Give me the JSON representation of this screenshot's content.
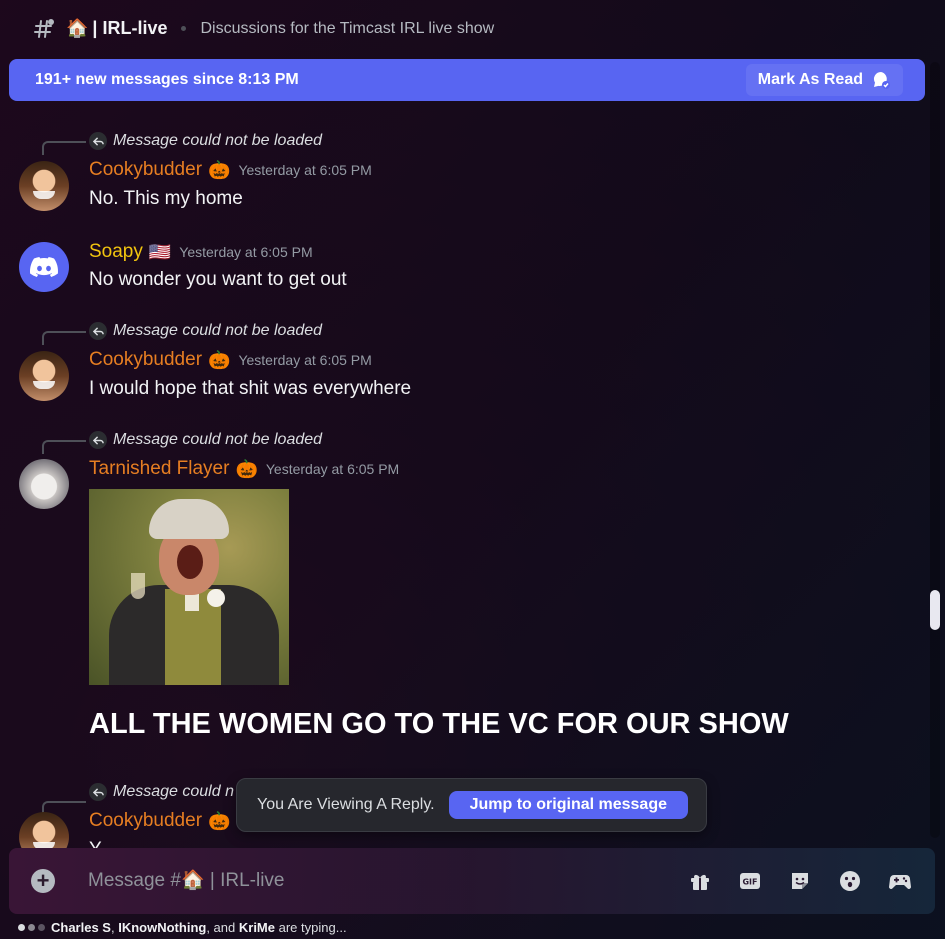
{
  "header": {
    "channel_emoji": "🏠",
    "channel_name": "| IRL-live",
    "topic": "Discussions for the Timcast IRL live show"
  },
  "banner": {
    "text": "191+ new messages since 8:13 PM",
    "mark_read_label": "Mark As Read"
  },
  "reply_ref_text": "Message could not be loaded",
  "messages": [
    {
      "author": "Cookybudder",
      "role_emoji": "🎃",
      "timestamp": "Yesterday at 6:05 PM",
      "text": "No. This my home",
      "is_reply": true
    },
    {
      "author": "Soapy",
      "role_emoji": "🇺🇸",
      "timestamp": "Yesterday at 6:05 PM",
      "text": "No wonder you want to get out",
      "is_reply": false
    },
    {
      "author": "Cookybudder",
      "role_emoji": "🎃",
      "timestamp": "Yesterday at 6:05 PM",
      "text": "I would hope that shit was everywhere",
      "is_reply": true
    },
    {
      "author": "Tarnished Flayer",
      "role_emoji": "🎃",
      "timestamp": "Yesterday at 6:05 PM",
      "text": "ALL THE WOMEN GO TO THE VC FOR OUR SHOW",
      "is_reply": true,
      "has_gif": true
    },
    {
      "author": "Cookybudder",
      "role_emoji": "🎃",
      "timestamp": "",
      "text": "Y",
      "is_reply": true
    }
  ],
  "partial_reply_text": "Message could n",
  "viewing_reply": {
    "text": "You Are Viewing A Reply.",
    "jump_label": "Jump to original message"
  },
  "composer": {
    "placeholder": "Message #🏠 | IRL-live"
  },
  "toolbar_icons": [
    "gift-icon",
    "gif-icon",
    "sticker-icon",
    "emoji-icon",
    "activities-icon"
  ],
  "typing": {
    "user1": "Charles S",
    "user2": "IKnowNothing",
    "user3": "KriMe",
    "sep1": ",",
    "sep2": ", and",
    "suffix": "are typing..."
  },
  "colors": {
    "accent": "#5865f2",
    "author_orange": "#e67e22",
    "author_yellow": "#f1c40f"
  }
}
